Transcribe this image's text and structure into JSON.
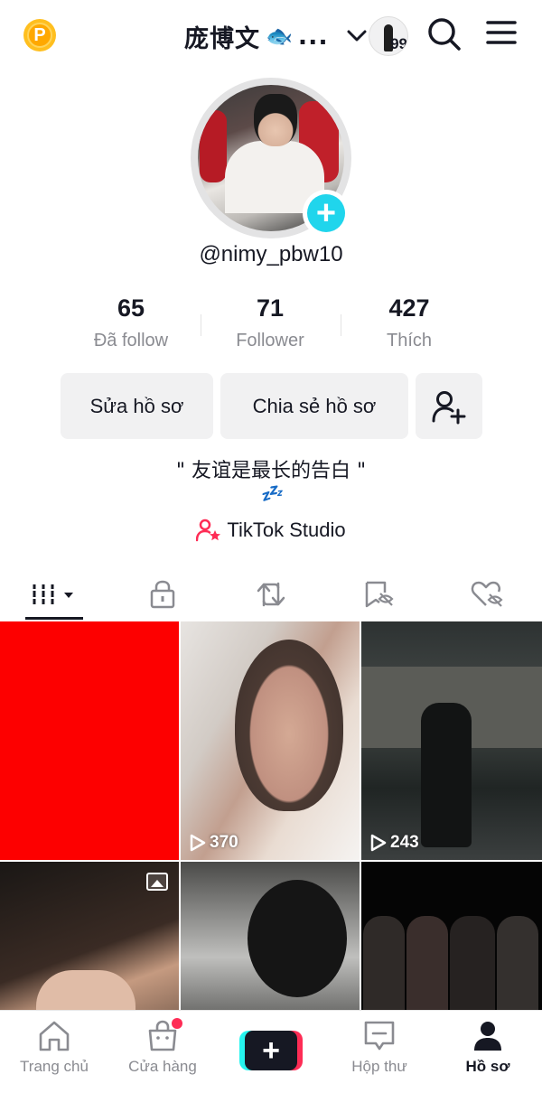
{
  "header": {
    "points_icon_text": "P",
    "account_name": "庞博文",
    "account_name_emoji": "🐟",
    "account_name_ellipsis": "...",
    "story_count": "99",
    "icons": {
      "points": "points-coin-icon",
      "switch": "chevron-down-icon",
      "search": "search-icon",
      "menu": "hamburger-menu-icon"
    }
  },
  "profile": {
    "username": "@nimy_pbw10",
    "add_story_symbol": "+",
    "stats": [
      {
        "value": "65",
        "label": "Đã follow"
      },
      {
        "value": "71",
        "label": "Follower"
      },
      {
        "value": "427",
        "label": "Thích"
      }
    ],
    "buttons": {
      "edit": "Sửa hồ sơ",
      "share": "Chia sẻ hồ sơ"
    },
    "bio": "\" 友谊是最长的告白 \"",
    "bio_emoji": "💤",
    "studio_label": "TikTok Studio"
  },
  "tabs": [
    {
      "name": "videos",
      "icon": "grid-icon",
      "active": true
    },
    {
      "name": "private",
      "icon": "lock-icon"
    },
    {
      "name": "reposts",
      "icon": "repost-icon"
    },
    {
      "name": "favorites",
      "icon": "bookmark-hidden-icon"
    },
    {
      "name": "liked",
      "icon": "heart-hidden-icon"
    }
  ],
  "videos": [
    {
      "views": ""
    },
    {
      "views": "370"
    },
    {
      "views": "243"
    },
    {
      "views": "",
      "is_photo": true
    },
    {
      "views": ""
    },
    {
      "views": ""
    }
  ],
  "bottom_nav": {
    "items": [
      {
        "label": "Trang chủ",
        "icon": "home-icon"
      },
      {
        "label": "Cửa hàng",
        "icon": "shop-bag-icon"
      },
      {
        "label": "",
        "icon": "create-plus-icon",
        "symbol": "+"
      },
      {
        "label": "Hộp thư",
        "icon": "inbox-icon"
      },
      {
        "label": "Hồ sơ",
        "icon": "profile-icon",
        "active": true
      }
    ]
  },
  "colors": {
    "accent_cyan": "#20d5ec",
    "accent_red": "#fe2c55",
    "text": "#161823",
    "muted": "#8a8b91"
  }
}
